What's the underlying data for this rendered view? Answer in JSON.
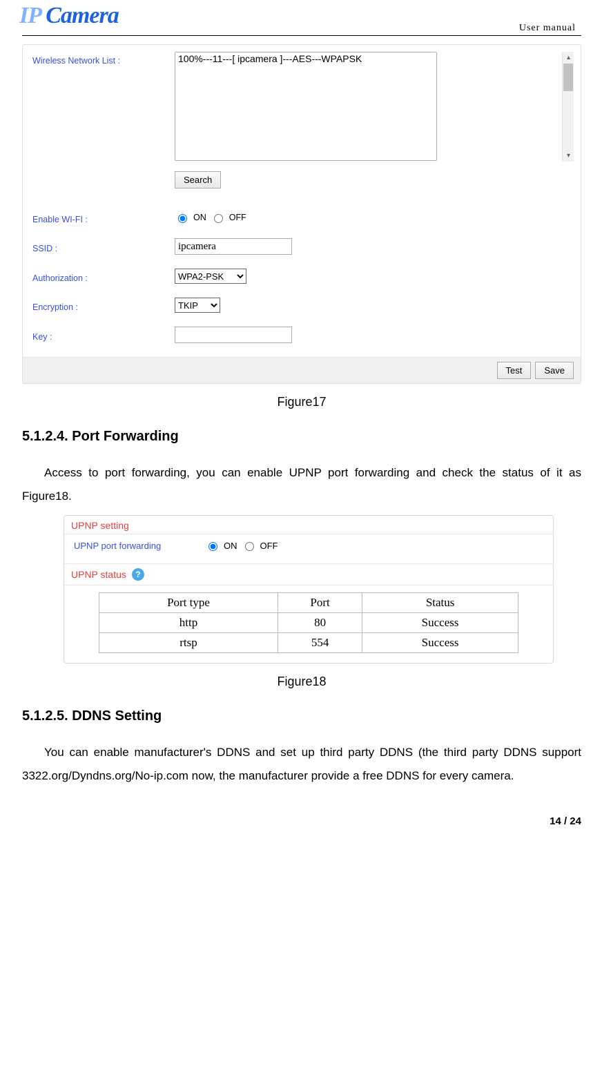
{
  "header": {
    "logo_text": "IP Camera",
    "right_text": "User manual"
  },
  "wifi": {
    "list_label": "Wireless Network List :",
    "list_item": "100%---11---[ ipcamera ]---AES---WPAPSK",
    "search_btn": "Search",
    "enable_label": "Enable WI-FI :",
    "on_text": "ON",
    "off_text": "OFF",
    "ssid_label": "SSID :",
    "ssid_value": "ipcamera",
    "auth_label": "Authorization :",
    "auth_value": "WPA2-PSK",
    "enc_label": "Encryption :",
    "enc_value": "TKIP",
    "key_label": "Key :",
    "test_btn": "Test",
    "save_btn": "Save"
  },
  "caption1": "Figure17",
  "section1": {
    "title": "5.1.2.4. Port Forwarding",
    "para": "Access to port forwarding, you can enable UPNP port forwarding and check the status of it as Figure18."
  },
  "upnp": {
    "setting_hdr": "UPNP setting",
    "forward_label": "UPNP port forwarding",
    "on": "ON",
    "off": "OFF",
    "status_hdr": "UPNP status",
    "table": {
      "h1": "Port type",
      "h2": "Port",
      "h3": "Status",
      "rows": [
        {
          "type": "http",
          "port": "80",
          "status": "Success"
        },
        {
          "type": "rtsp",
          "port": "554",
          "status": "Success"
        }
      ]
    }
  },
  "caption2": "Figure18",
  "section2": {
    "title": "5.1.2.5. DDNS Setting",
    "para": "You can enable manufacturer's DDNS and set up third party DDNS (the third party DDNS support 3322.org/Dyndns.org/No-ip.com now, the manufacturer provide a free DDNS for every camera."
  },
  "footer": "14 / 24"
}
